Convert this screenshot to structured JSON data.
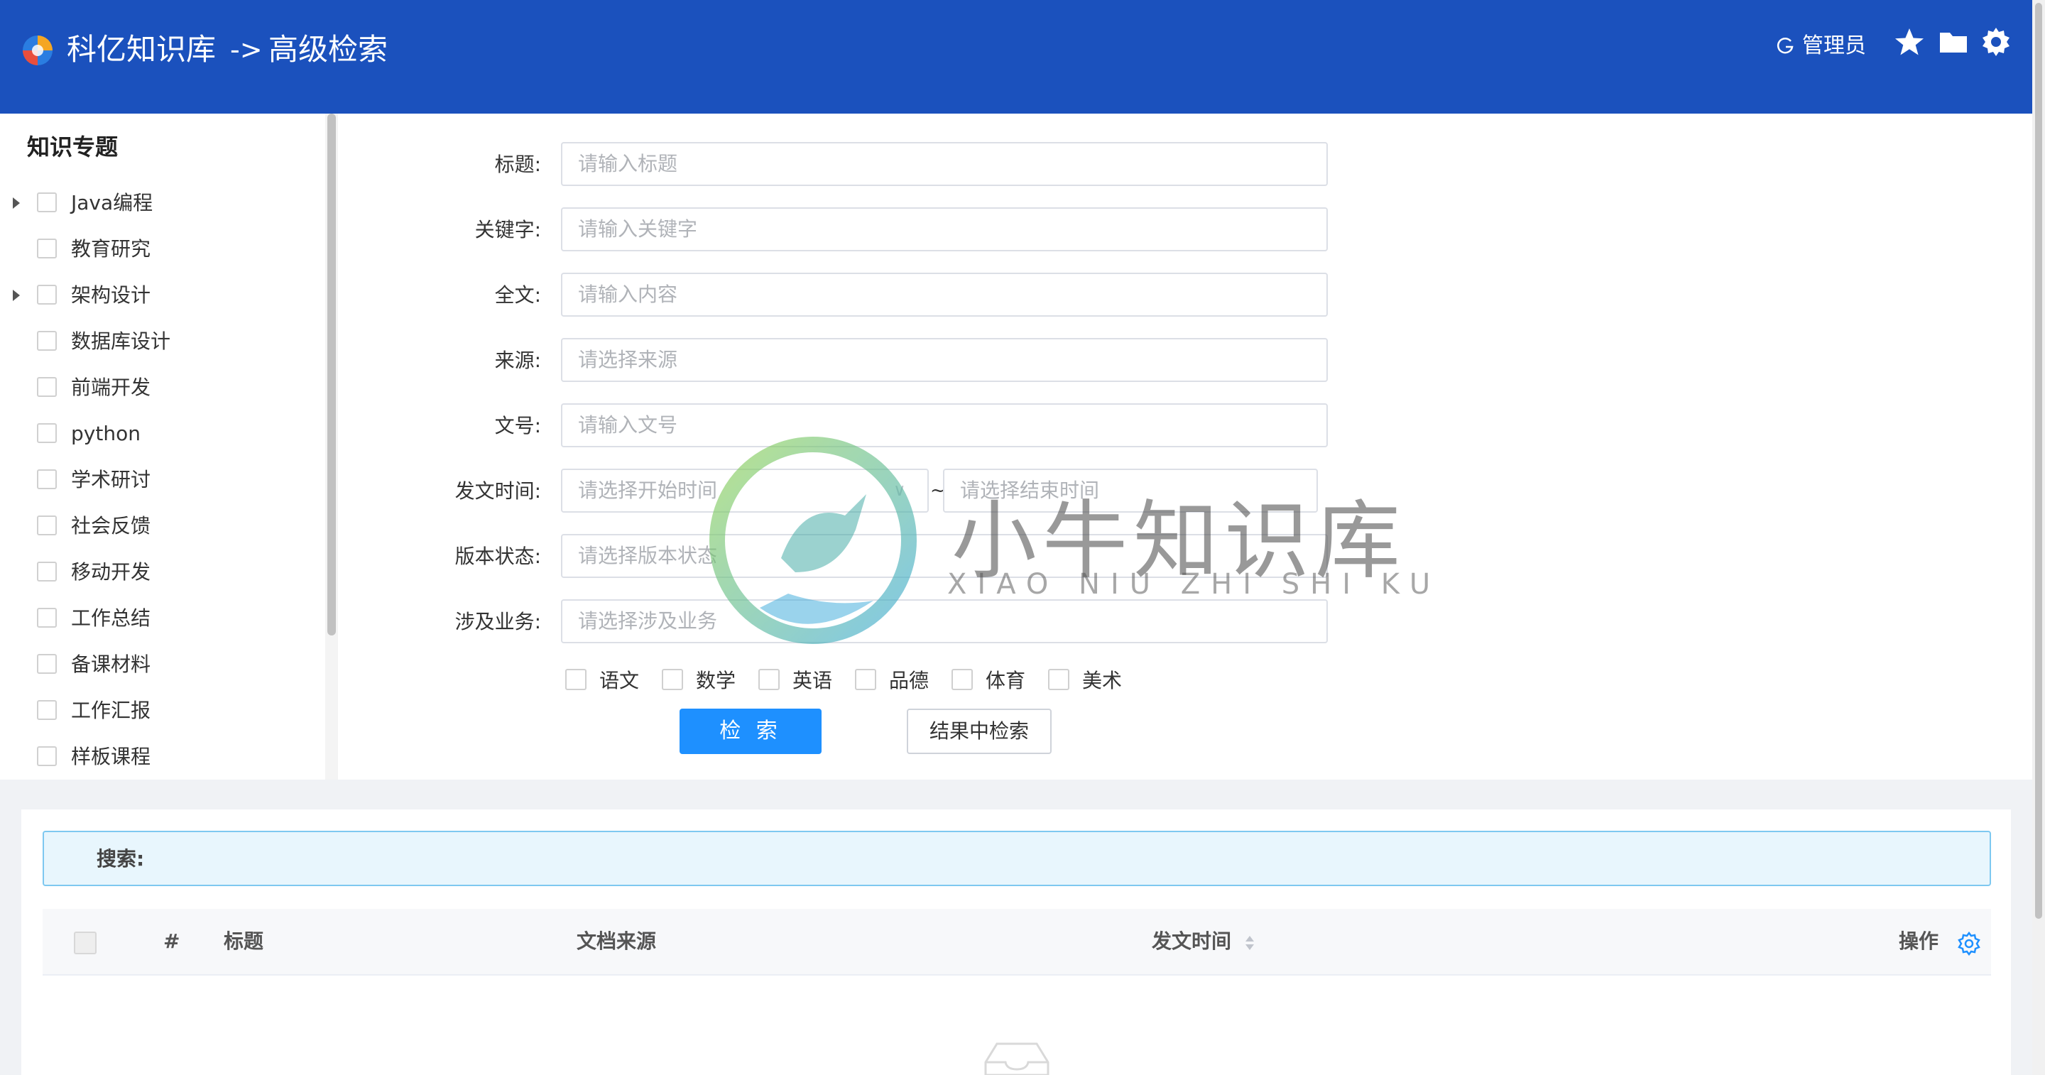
{
  "header": {
    "app_title": "科亿知识库",
    "crumb_arrow": "->",
    "page_title": "高级检索",
    "user_label": "管理员",
    "icons": [
      "star-icon",
      "folder-icon",
      "settings-icon"
    ],
    "colors": {
      "bar": "#1b51bd",
      "text": "#ffffff"
    }
  },
  "sidebar": {
    "title": "知识专题",
    "items": [
      {
        "label": "Java编程",
        "expandable": true
      },
      {
        "label": "教育研究",
        "expandable": false
      },
      {
        "label": "架构设计",
        "expandable": true
      },
      {
        "label": "数据库设计",
        "expandable": false
      },
      {
        "label": "前端开发",
        "expandable": false
      },
      {
        "label": "python",
        "expandable": false
      },
      {
        "label": "学术研讨",
        "expandable": false
      },
      {
        "label": "社会反馈",
        "expandable": false
      },
      {
        "label": "移动开发",
        "expandable": false
      },
      {
        "label": "工作总结",
        "expandable": false
      },
      {
        "label": "备课材料",
        "expandable": false
      },
      {
        "label": "工作汇报",
        "expandable": false
      },
      {
        "label": "样板课程",
        "expandable": false
      }
    ]
  },
  "form": {
    "title": {
      "label": "标题:",
      "placeholder": "请输入标题"
    },
    "keyword": {
      "label": "关键字:",
      "placeholder": "请输入关键字"
    },
    "fulltext": {
      "label": "全文:",
      "placeholder": "请输入内容"
    },
    "source": {
      "label": "来源:",
      "placeholder": "请选择来源"
    },
    "docno": {
      "label": "文号:",
      "placeholder": "请输入文号"
    },
    "date": {
      "label": "发文时间:",
      "start_placeholder": "请选择开始时间",
      "separator": "~",
      "end_placeholder": "请选择结束时间"
    },
    "version": {
      "label": "版本状态:",
      "placeholder": "请选择版本状态"
    },
    "business": {
      "label": "涉及业务:",
      "placeholder": "请选择涉及业务"
    },
    "subjects": [
      "语文",
      "数学",
      "英语",
      "品德",
      "体育",
      "美术"
    ],
    "search_button": "检 索",
    "within_button": "结果中检索"
  },
  "watermark": {
    "cn": "小牛知识库",
    "en": "XIAO NIU ZHI SHI KU"
  },
  "results": {
    "search_label": "搜索:",
    "columns": [
      "#",
      "标题",
      "文档来源",
      "发文时间",
      "操作"
    ],
    "accent": "#1e90ff"
  }
}
